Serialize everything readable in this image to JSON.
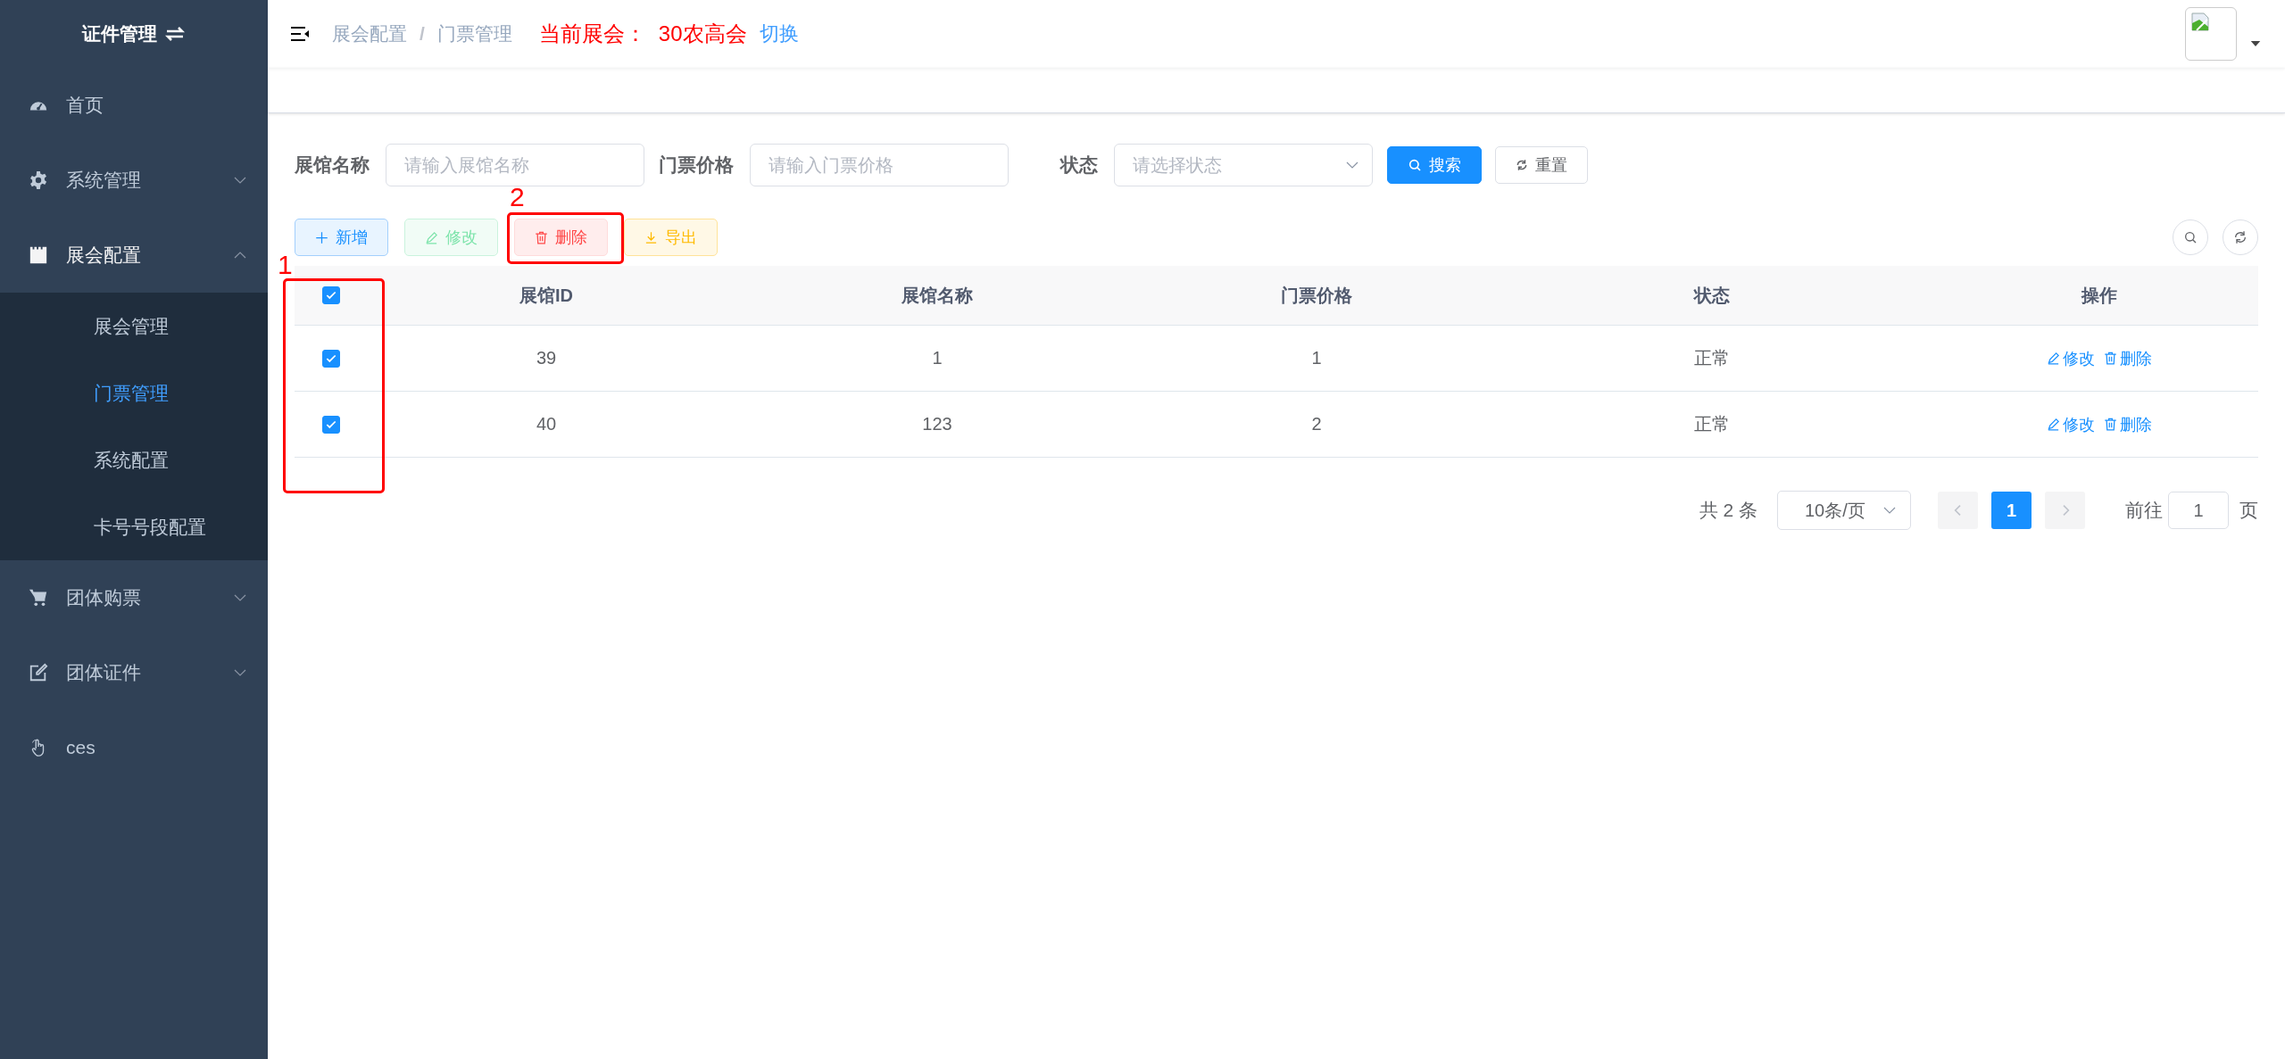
{
  "sidebar": {
    "title": "证件管理",
    "items": [
      {
        "label": "首页",
        "kind": "dashboard"
      },
      {
        "label": "系统管理",
        "kind": "gear",
        "expanded": false
      },
      {
        "label": "展会配置",
        "kind": "board",
        "expanded": true,
        "children": [
          {
            "label": "展会管理",
            "selected": false
          },
          {
            "label": "门票管理",
            "selected": true
          },
          {
            "label": "系统配置",
            "selected": false
          },
          {
            "label": "卡号号段配置",
            "selected": false
          }
        ]
      },
      {
        "label": "团体购票",
        "kind": "cart",
        "expanded": false
      },
      {
        "label": "团体证件",
        "kind": "edit",
        "expanded": false
      },
      {
        "label": "ces",
        "kind": "hand"
      }
    ]
  },
  "header": {
    "breadcrumb": [
      "展会配置",
      "门票管理"
    ],
    "separator": "/",
    "current_label": "当前展会：",
    "current_value": "30农高会",
    "switch_link": "切换"
  },
  "filters": [
    {
      "kind": "input",
      "label": "展馆名称",
      "placeholder": "请输入展馆名称"
    },
    {
      "kind": "input",
      "label": "门票价格",
      "placeholder": "请输入门票价格"
    },
    {
      "kind": "select",
      "label": "状态",
      "placeholder": "请选择状态"
    }
  ],
  "search_button": "搜索",
  "reset_button": "重置",
  "toolbar": [
    {
      "kind": "add",
      "label": "新增",
      "disabled": false
    },
    {
      "kind": "edit",
      "label": "修改",
      "disabled": true
    },
    {
      "kind": "delete",
      "label": "删除",
      "disabled": false
    },
    {
      "kind": "export",
      "label": "导出",
      "disabled": false
    }
  ],
  "table": {
    "all_checked": true,
    "columns": [
      "展馆ID",
      "展馆名称",
      "门票价格",
      "状态",
      "操作"
    ],
    "rows": [
      {
        "checked": true,
        "cells": [
          "39",
          "1",
          "1",
          "正常"
        ],
        "actions": [
          "修改",
          "删除"
        ]
      },
      {
        "checked": true,
        "cells": [
          "40",
          "123",
          "2",
          "正常"
        ],
        "actions": [
          "修改",
          "删除"
        ]
      }
    ]
  },
  "pagination": {
    "total": "共 2 条",
    "page_size": "10条/页",
    "pages": [
      {
        "label": "1",
        "selected": true
      }
    ],
    "jump_label": "前往",
    "jump_value": "1",
    "jump_suffix": "页"
  },
  "annotations": [
    {
      "label": "1"
    },
    {
      "label": "2"
    }
  ]
}
